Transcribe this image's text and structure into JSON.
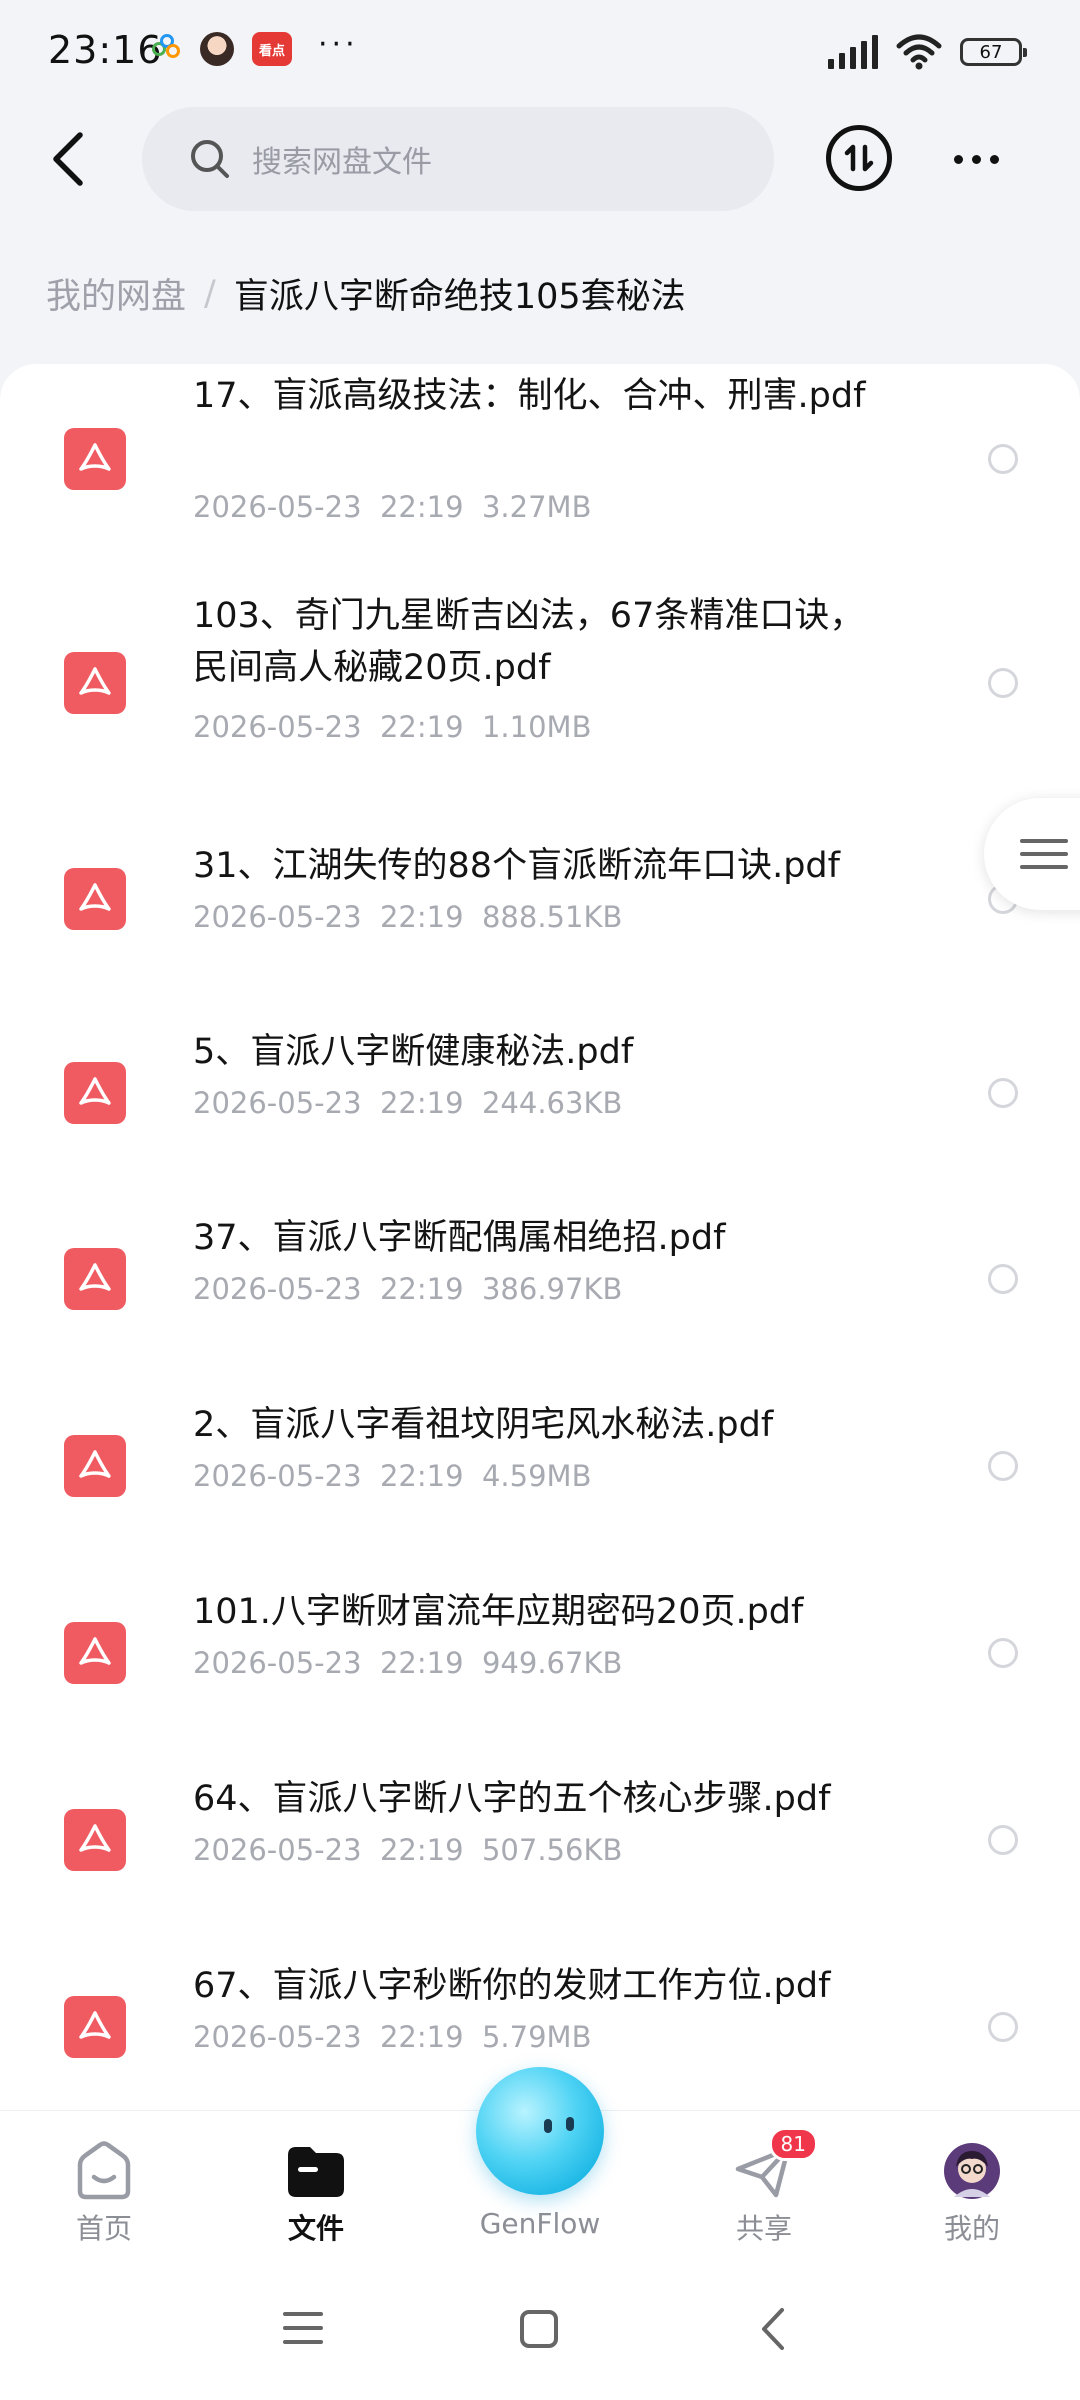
{
  "status_bar": {
    "time": "23:16",
    "notification_kandian": "看点",
    "notification_more": "···",
    "battery": "67"
  },
  "header": {
    "search_placeholder": "搜索网盘文件"
  },
  "breadcrumb": {
    "root": "我的网盘",
    "separator": "/",
    "current": "盲派八字断命绝技105套秘法"
  },
  "files": [
    {
      "name": "17、盲派高级技法：制化、合冲、刑害.pdf",
      "meta": "2026-05-23  22:19  3.27MB"
    },
    {
      "name": "103、奇门九星断吉凶法，67条精准口诀，民间高人秘藏20页.pdf",
      "meta": "2026-05-23  22:19  1.10MB"
    },
    {
      "name": "31、江湖失传的88个盲派断流年口诀.pdf",
      "meta": "2026-05-23  22:19  888.51KB"
    },
    {
      "name": "5、盲派八字断健康秘法.pdf",
      "meta": "2026-05-23  22:19  244.63KB"
    },
    {
      "name": "37、盲派八字断配偶属相绝招.pdf",
      "meta": "2026-05-23  22:19  386.97KB"
    },
    {
      "name": "2、盲派八字看祖坟阴宅风水秘法.pdf",
      "meta": "2026-05-23  22:19  4.59MB"
    },
    {
      "name": "101.八字断财富流年应期密码20页.pdf",
      "meta": "2026-05-23  22:19  949.67KB"
    },
    {
      "name": "64、盲派八字断八字的五个核心步骤.pdf",
      "meta": "2026-05-23  22:19  507.56KB"
    },
    {
      "name": "67、盲派八字秒断你的发财工作方位.pdf",
      "meta": "2026-05-23  22:19  5.79MB"
    }
  ],
  "bottom_nav": {
    "home": "首页",
    "files": "文件",
    "genflow": "GenFlow",
    "share": "共享",
    "share_badge": "81",
    "mine": "我的"
  },
  "colors": {
    "pdf_icon": "#f05b62",
    "badge": "#f0364a",
    "genflow": "#19b5e4"
  }
}
